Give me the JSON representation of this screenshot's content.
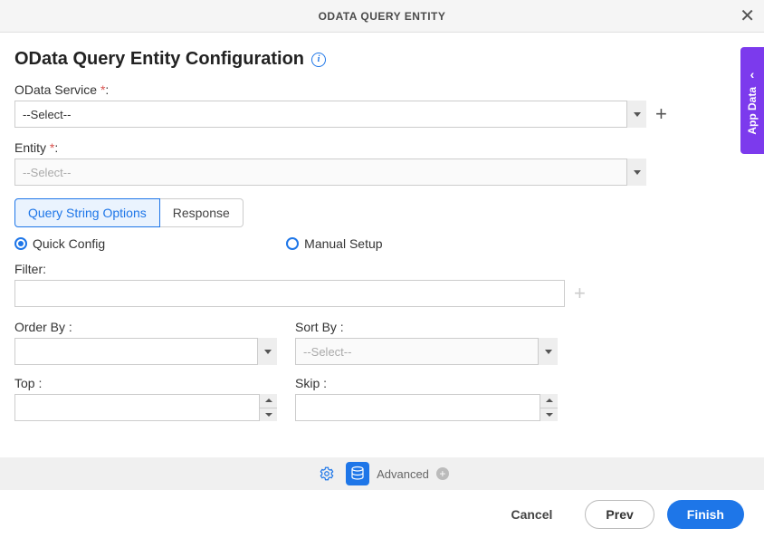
{
  "header": {
    "title": "ODATA QUERY ENTITY"
  },
  "page": {
    "heading": "OData Query Entity Configuration"
  },
  "fields": {
    "odataService": {
      "label": "OData Service",
      "required": "*",
      "value": "--Select--"
    },
    "entity": {
      "label": "Entity",
      "required": "*",
      "placeholder": "--Select--"
    },
    "filter": {
      "label": "Filter:"
    },
    "orderBy": {
      "label": "Order By :"
    },
    "sortBy": {
      "label": "Sort By :",
      "placeholder": "--Select--"
    },
    "top": {
      "label": "Top :"
    },
    "skip": {
      "label": "Skip :"
    }
  },
  "tabs": {
    "query": "Query String Options",
    "response": "Response"
  },
  "configMode": {
    "quick": "Quick Config",
    "manual": "Manual Setup"
  },
  "advanced": {
    "label": "Advanced"
  },
  "footer": {
    "cancel": "Cancel",
    "prev": "Prev",
    "finish": "Finish"
  },
  "sideTab": {
    "label": "App Data"
  }
}
